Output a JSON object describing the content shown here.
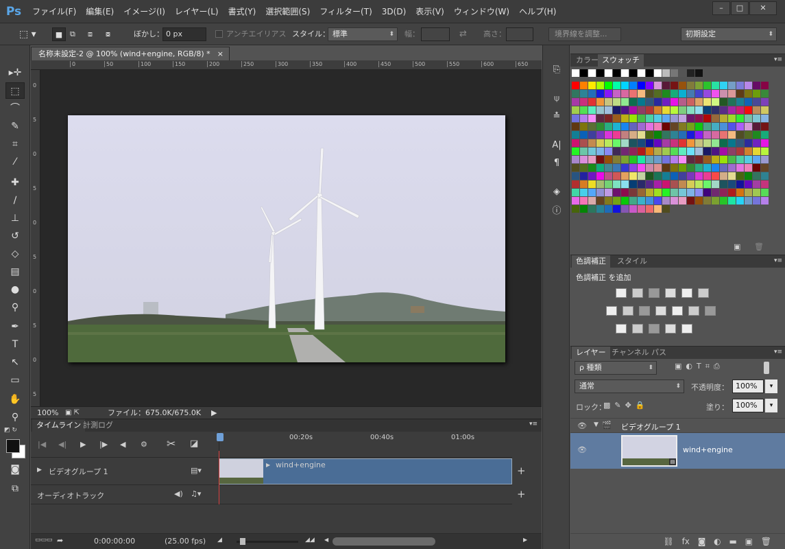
{
  "app": {
    "logo": "Ps"
  },
  "menu": [
    "ファイル(F)",
    "編集(E)",
    "イメージ(I)",
    "レイヤー(L)",
    "書式(Y)",
    "選択範囲(S)",
    "フィルター(T)",
    "3D(D)",
    "表示(V)",
    "ウィンドウ(W)",
    "ヘルプ(H)"
  ],
  "window_controls": [
    "–",
    "□",
    "✕"
  ],
  "options": {
    "feather_label": "ぼかし：",
    "feather_value": "0 px",
    "antialias_label": "アンチエイリアス",
    "style_label": "スタイル：",
    "style_value": "標準",
    "width_label": "幅：",
    "height_label": "高さ：",
    "refine_edge": "境界線を調整...",
    "workspace": "初期設定"
  },
  "document": {
    "tab_title": "名称未設定-2 @ 100% (wind+engine, RGB/8) *",
    "close": "×"
  },
  "ruler_top": [
    "0",
    "50",
    "100",
    "150",
    "200",
    "250",
    "300",
    "350",
    "400",
    "450",
    "500",
    "550",
    "600",
    "650"
  ],
  "ruler_left": [
    "0",
    "5",
    "0",
    "5",
    "0",
    "5",
    "0",
    "5",
    "0",
    "5"
  ],
  "status": {
    "zoom": "100%",
    "file_info": "ファイル：675.0K/675.0K"
  },
  "timeline": {
    "tab_timeline": "タイムライン",
    "tab_measure": "計測ログ",
    "marks": [
      "00:20s",
      "00:40s",
      "01:00s"
    ],
    "video_group": "ビデオグループ 1",
    "clip_name": "wind+engine",
    "audio_track": "オーディオトラック",
    "timecode": "0:00:00:00",
    "fps": "(25.00 fps)"
  },
  "color_panel": {
    "tab_color": "カラー",
    "tab_swatches": "スウォッチ"
  },
  "adjust_panel": {
    "tab_adjust": "色調補正",
    "tab_styles": "スタイル",
    "add_label": "色調補正 を追加"
  },
  "layers_panel": {
    "tab_layers": "レイヤー",
    "tab_channels": "チャンネル",
    "tab_paths": "パス",
    "filter_kind": "ρ 種類",
    "blend_mode": "通常",
    "opacity_label": "不透明度：",
    "opacity_value": "100%",
    "lock_label": "ロック：",
    "fill_label": "塗り：",
    "fill_value": "100%",
    "group_name": "ビデオグループ 1",
    "layer_name": "wind+engine"
  },
  "colors": {
    "accent": "#4a6d96",
    "playhead": "#d84040"
  }
}
